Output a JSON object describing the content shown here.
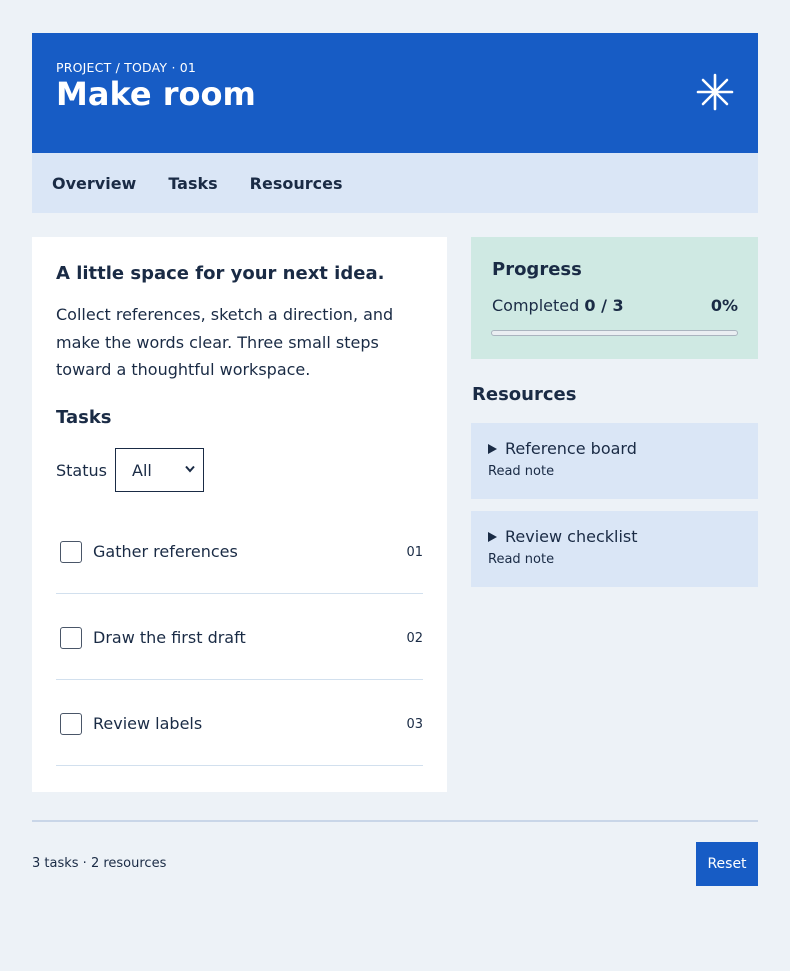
{
  "header": {
    "breadcrumb": "PROJECT / TODAY · 01",
    "title": "Make room",
    "icon": "asterisk-icon"
  },
  "nav": {
    "items": [
      {
        "label": "Overview"
      },
      {
        "label": "Tasks"
      },
      {
        "label": "Resources"
      }
    ]
  },
  "main": {
    "lead": "A little space for your next idea.",
    "description": "Collect references, sketch a direction, and make the words clear. Three small steps toward a thoughtful workspace.",
    "tasks_heading": "Tasks",
    "status_label": "Status",
    "status_value": "All",
    "tasks": [
      {
        "label": "Gather references",
        "number": "01",
        "checked": false
      },
      {
        "label": "Draw the first draft",
        "number": "02",
        "checked": false
      },
      {
        "label": "Review labels",
        "number": "03",
        "checked": false
      }
    ]
  },
  "progress": {
    "heading": "Progress",
    "completed_label": "Completed",
    "completed_value": "0 / 3",
    "percent_label": "0%",
    "fraction": 0
  },
  "resources": {
    "heading": "Resources",
    "items": [
      {
        "title": "Reference board",
        "note": "Read note"
      },
      {
        "title": "Review checklist",
        "note": "Read note"
      }
    ]
  },
  "footer": {
    "summary": "3 tasks · 2 resources",
    "reset_label": "Reset"
  },
  "colors": {
    "accent": "#175cc5",
    "background": "#edf2f7",
    "nav_bg": "#dae6f6",
    "progress_bg": "#cfe9e3",
    "text": "#1a2b45"
  }
}
